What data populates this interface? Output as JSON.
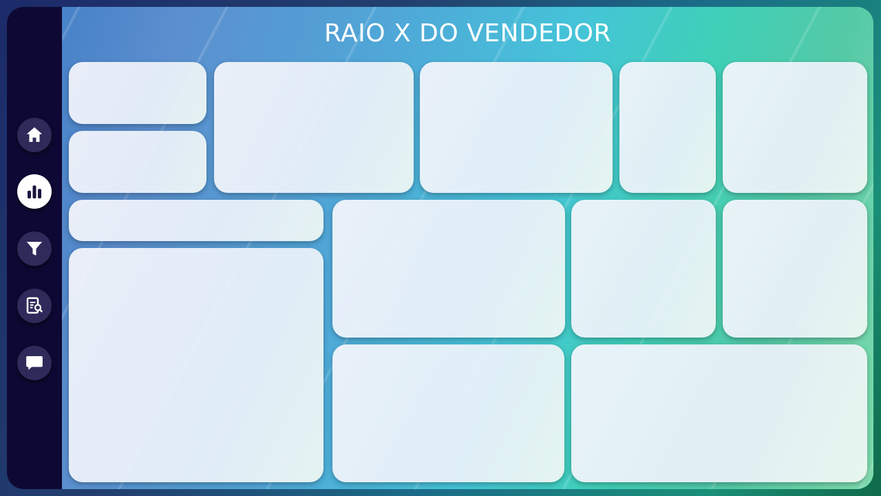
{
  "title": "RAIO X DO VENDEDOR",
  "colors": {
    "sidebar": "#0e0934",
    "nav_button": "#2e2a5a",
    "nav_active": "#ffffff",
    "card": "#eef1f8"
  },
  "nav": [
    {
      "icon": "home-icon"
    },
    {
      "icon": "bar-chart-icon",
      "active": true
    },
    {
      "icon": "filter-icon"
    },
    {
      "icon": "report-search-icon"
    },
    {
      "icon": "chat-icon"
    }
  ]
}
